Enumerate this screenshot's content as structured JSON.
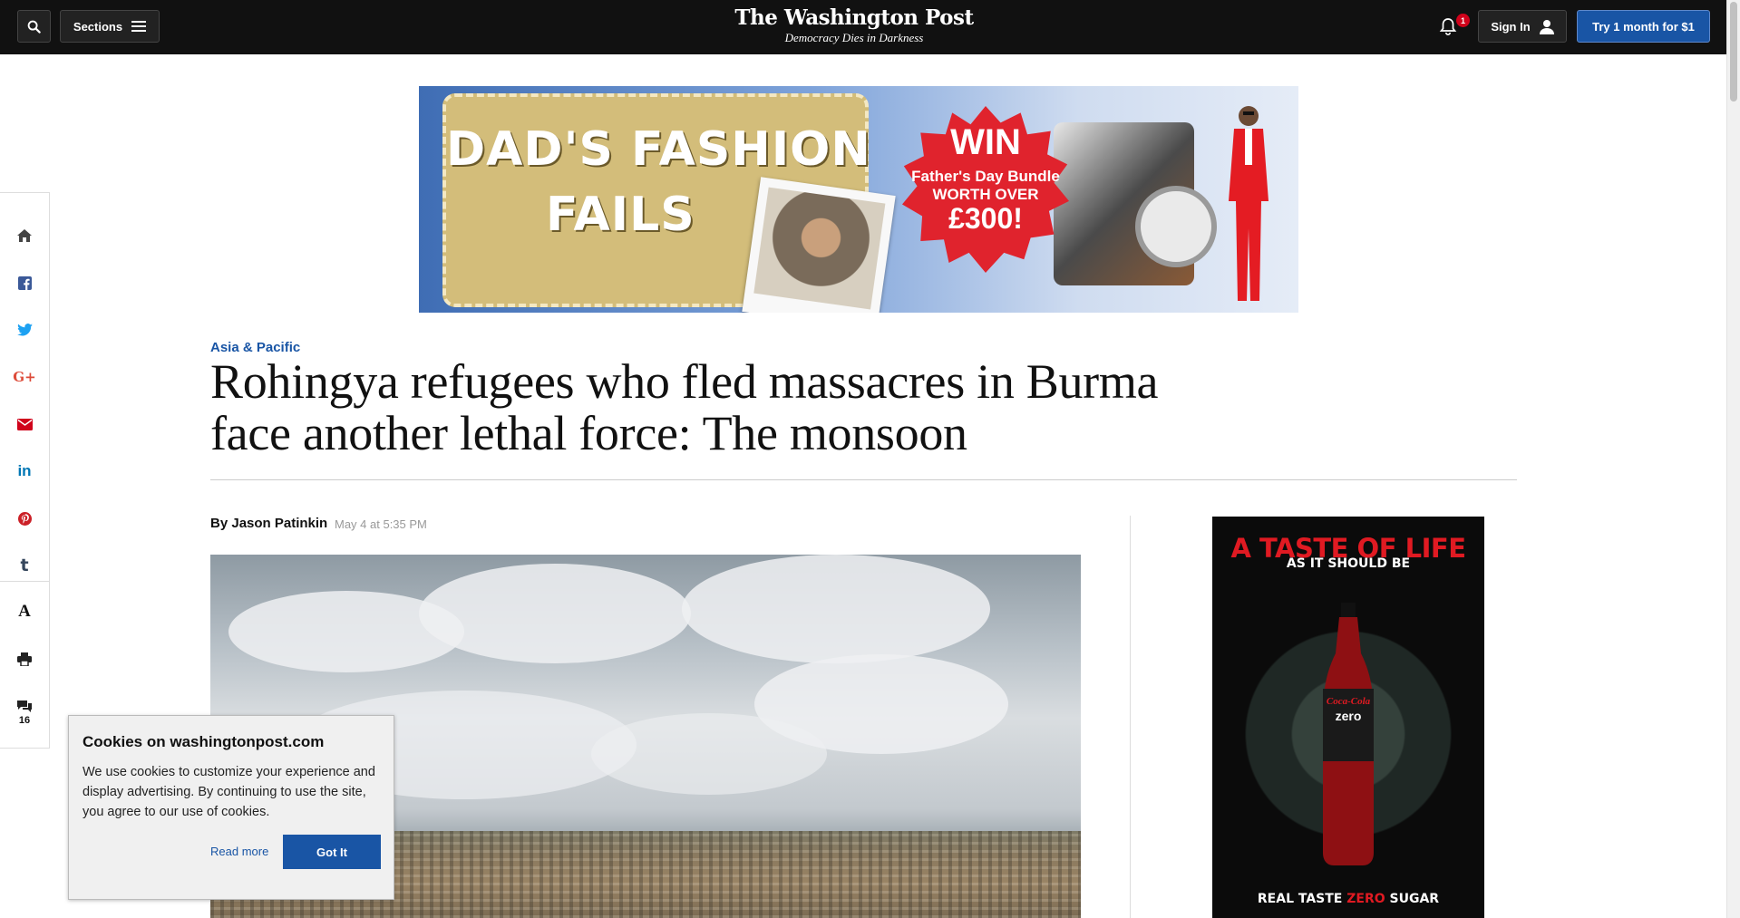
{
  "header": {
    "sections_label": "Sections",
    "brand_name": "The Washington Post",
    "brand_tagline": "Democracy Dies in Darkness",
    "notification_count": "1",
    "signin_label": "Sign In",
    "subscribe_label": "Try 1 month for $1"
  },
  "banner_ad": {
    "line1": "DAD'S FASHION",
    "line2": "FAILS",
    "burst_win": "WIN",
    "burst_line1": "Father's Day Bundle",
    "burst_line2": "WORTH OVER",
    "burst_amount": "£300!"
  },
  "share_rail": {
    "items": [
      "home-icon",
      "facebook-icon",
      "twitter-icon",
      "google-plus-icon",
      "email-icon",
      "linkedin-icon",
      "pinterest-icon",
      "tumblr-icon",
      "font-size-icon",
      "print-icon",
      "comments-icon"
    ],
    "comment_count": "16"
  },
  "article": {
    "kicker": "Asia & Pacific",
    "headline": "Rohingya refugees who fled massacres in Burma face another lethal force: The monsoon",
    "byline_prefix": "By",
    "author": "Jason Patinkin",
    "timestamp": "May 4 at 5:35 PM"
  },
  "side_ad": {
    "headline": "A TASTE OF LIFE",
    "subhead": "AS IT SHOULD BE",
    "brand": "Coca-Cola",
    "product": "zero",
    "footer_a": "REAL TASTE",
    "footer_b": "ZERO",
    "footer_c": "SUGAR"
  },
  "cookie_notice": {
    "title": "Cookies on washingtonpost.com",
    "body": "We use cookies to customize your experience and display advertising. By continuing to use the site, you agree to our use of cookies.",
    "read_more": "Read more",
    "accept": "Got It"
  },
  "colors": {
    "header_bg": "#111111",
    "accent_blue": "#1955a5",
    "badge_red": "#d0021b",
    "share_red": "#d0021b"
  }
}
